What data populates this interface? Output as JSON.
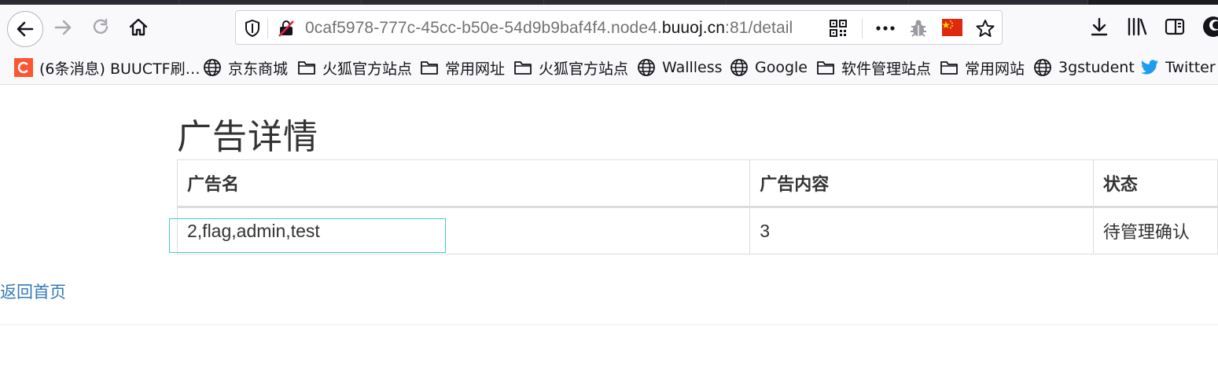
{
  "browser": {
    "url_prefix": "0caf5978-777c-45cc-b50e-54d9b9baf4f4.node4.",
    "url_host": "buuoj.cn",
    "url_suffix": ":81/detail",
    "bookmarks": [
      {
        "label": "(6条消息) BUUCTF刷…",
        "icon": "csdn-icon"
      },
      {
        "label": "京东商城",
        "icon": "globe-icon"
      },
      {
        "label": "火狐官方站点",
        "icon": "folder-icon"
      },
      {
        "label": "常用网址",
        "icon": "folder-icon"
      },
      {
        "label": "火狐官方站点",
        "icon": "folder-icon"
      },
      {
        "label": "Wallless",
        "icon": "globe-icon"
      },
      {
        "label": "Google",
        "icon": "globe-icon"
      },
      {
        "label": "软件管理站点",
        "icon": "folder-icon"
      },
      {
        "label": "常用网站",
        "icon": "folder-icon"
      },
      {
        "label": "3gstudent",
        "icon": "globe-icon"
      },
      {
        "label": "Twitter",
        "icon": "twitter-icon"
      }
    ],
    "colors": {
      "csdn": "#fc5531",
      "twitter": "#1d9bf0",
      "link": "#337ab7"
    }
  },
  "page": {
    "title": "广告详情",
    "table": {
      "headers": [
        "广告名",
        "广告内容",
        "状态"
      ],
      "rows": [
        [
          "2,flag,admin,test",
          "3",
          "待管理确认"
        ]
      ]
    },
    "back_link": "返回首页"
  }
}
